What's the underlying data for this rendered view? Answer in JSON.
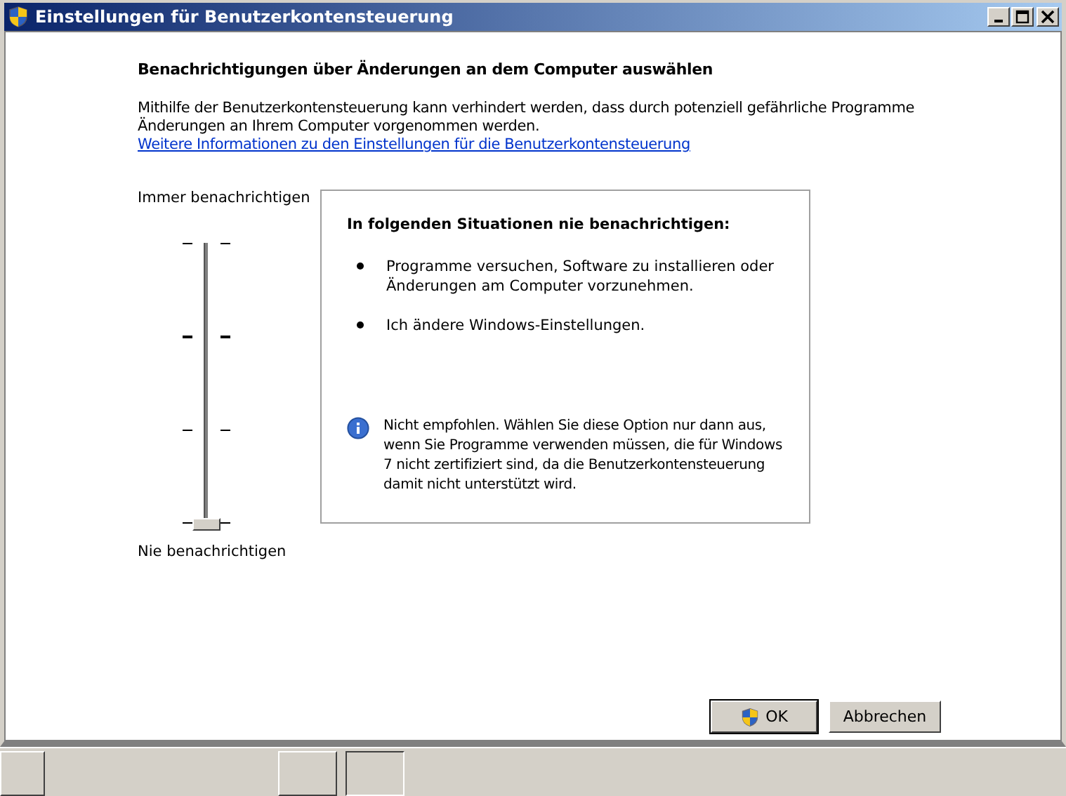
{
  "window": {
    "title": "Einstellungen für Benutzerkontensteuerung"
  },
  "heading": "Benachrichtigungen über Änderungen an dem Computer auswählen",
  "description": "Mithilfe der Benutzerkontensteuerung kann verhindert werden, dass durch potenziell gefährliche Programme Änderungen an Ihrem Computer vorgenommen werden.",
  "link": "Weitere Informationen zu den Einstellungen für die Benutzerkontensteuerung",
  "slider": {
    "top_label": "Immer benachrichtigen",
    "bottom_label": "Nie benachrichtigen",
    "level": 0
  },
  "info_panel": {
    "title": "In folgenden Situationen nie benachrichtigen:",
    "bullets": [
      {
        "text": "Programme versuchen, Software zu installieren oder Änderungen am Computer vorzunehmen."
      },
      {
        "text": "Ich ändere Windows-Einstellungen."
      }
    ],
    "note": "Nicht empfohlen. Wählen Sie diese Option nur dann aus, wenn Sie Programme verwenden müssen, die für Windows 7 nicht zertifiziert sind, da die Benutzerkontensteuerung damit nicht unterstützt wird."
  },
  "buttons": [
    {
      "label": "OK",
      "kind": "shield"
    },
    {
      "label": "Abbrechen",
      "kind": "plain"
    }
  ]
}
